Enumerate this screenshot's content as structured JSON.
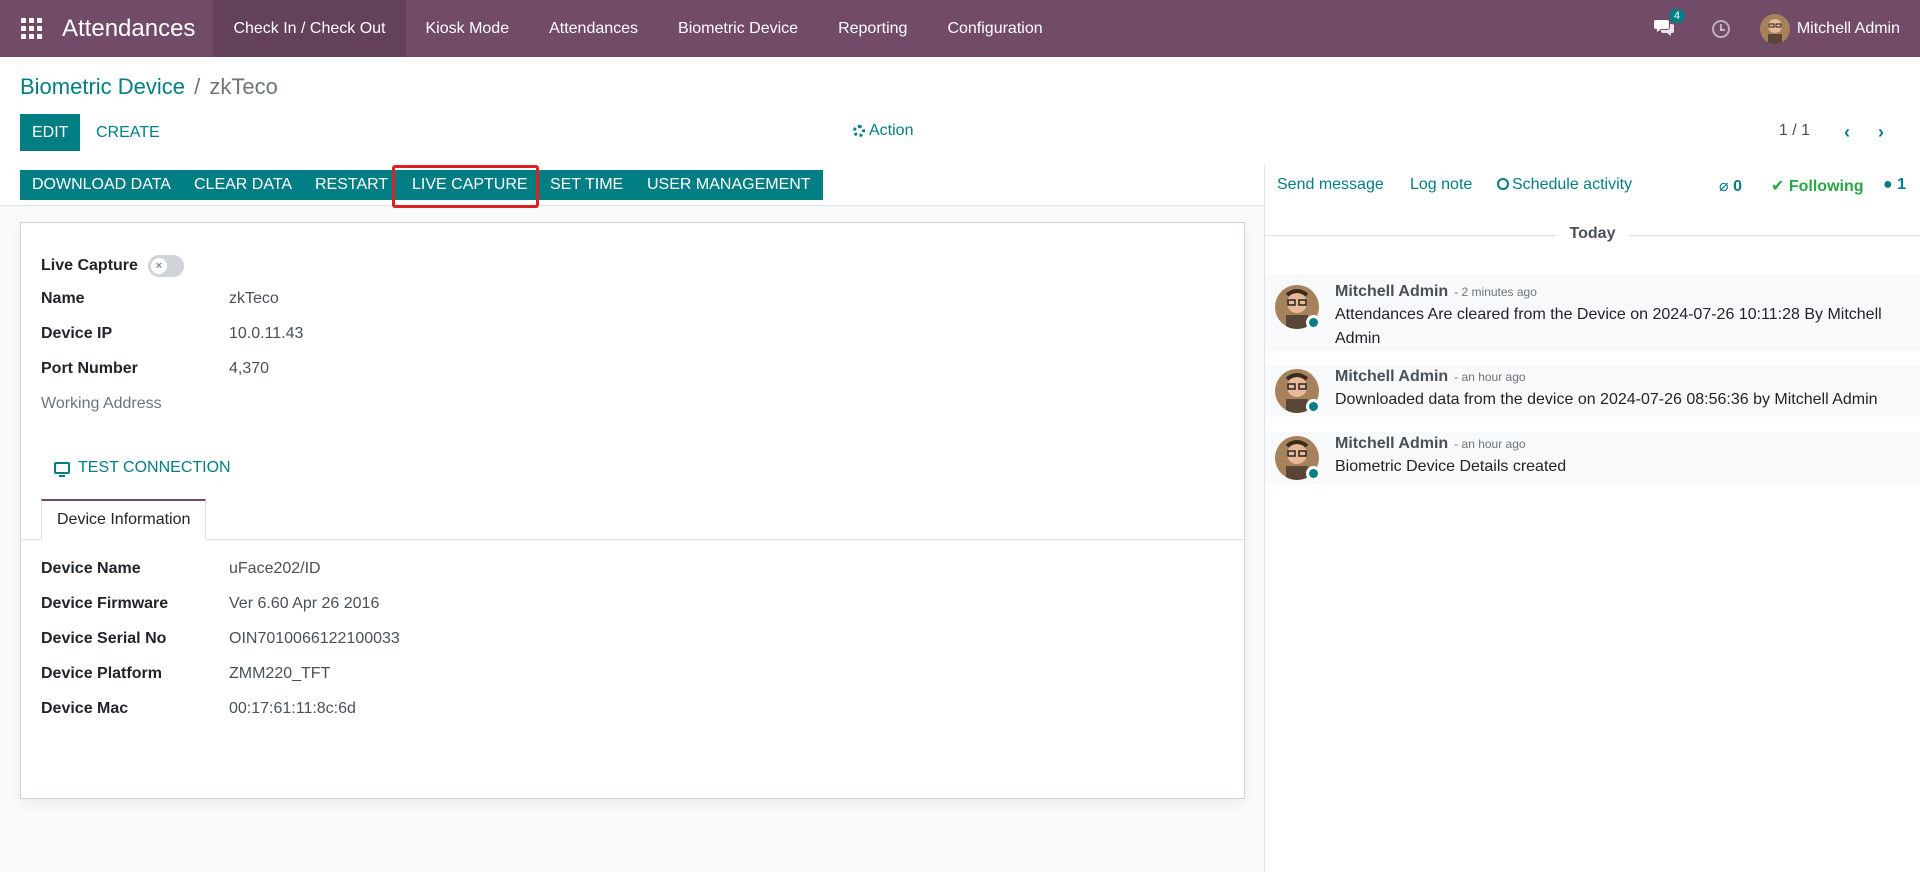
{
  "navbar": {
    "app_title": "Attendances",
    "menu": [
      {
        "label": "Check In / Check Out",
        "active": true
      },
      {
        "label": "Kiosk Mode"
      },
      {
        "label": "Attendances"
      },
      {
        "label": "Biometric Device"
      },
      {
        "label": "Reporting"
      },
      {
        "label": "Configuration"
      }
    ],
    "chat_badge": "4",
    "user_name": "Mitchell Admin"
  },
  "breadcrumb": {
    "parent": "Biometric Device",
    "separator": "/",
    "current": "zkTeco"
  },
  "buttons": {
    "edit": "EDIT",
    "create": "CREATE",
    "action": "Action"
  },
  "pager": {
    "text": "1 / 1",
    "prev": "‹",
    "next": "›"
  },
  "statusbar": [
    "DOWNLOAD DATA",
    "CLEAR DATA",
    "RESTART",
    "LIVE CAPTURE",
    "SET TIME",
    "USER MANAGEMENT"
  ],
  "form": {
    "live_capture_label": "Live Capture",
    "live_capture_on": false,
    "fields": [
      {
        "label": "Name",
        "value": "zkTeco"
      },
      {
        "label": "Device IP",
        "value": "10.0.11.43"
      },
      {
        "label": "Port Number",
        "value": "4,370"
      },
      {
        "label": "Working Address",
        "value": ""
      }
    ],
    "test_connection": "TEST CONNECTION",
    "tab_label": "Device Information",
    "device_fields": [
      {
        "label": "Device Name",
        "value": "uFace202/ID"
      },
      {
        "label": "Device Firmware",
        "value": "Ver 6.60 Apr 26 2016"
      },
      {
        "label": "Device Serial No",
        "value": "OIN7010066122100033"
      },
      {
        "label": "Device Platform",
        "value": "ZMM220_TFT"
      },
      {
        "label": "Device Mac",
        "value": "00:17:61:11:8c:6d"
      }
    ]
  },
  "chatter": {
    "send_message": "Send message",
    "log_note": "Log note",
    "schedule_activity": "Schedule activity",
    "attachments": "0",
    "following": "Following",
    "followers": "1",
    "today": "Today",
    "messages": [
      {
        "author": "Mitchell Admin",
        "time": "- 2 minutes ago",
        "body": "Attendances Are cleared from the Device on 2024-07-26 10:11:28 By Mitchell Admin"
      },
      {
        "author": "Mitchell Admin",
        "time": "- an hour ago",
        "body": "Downloaded data from the device on 2024-07-26 08:56:36 by Mitchell Admin"
      },
      {
        "author": "Mitchell Admin",
        "time": "- an hour ago",
        "body": "Biometric Device Details created"
      }
    ]
  },
  "colors": {
    "brand": "#714b67",
    "accent": "#017e84",
    "highlight": "#e02020",
    "following": "#28a745"
  }
}
